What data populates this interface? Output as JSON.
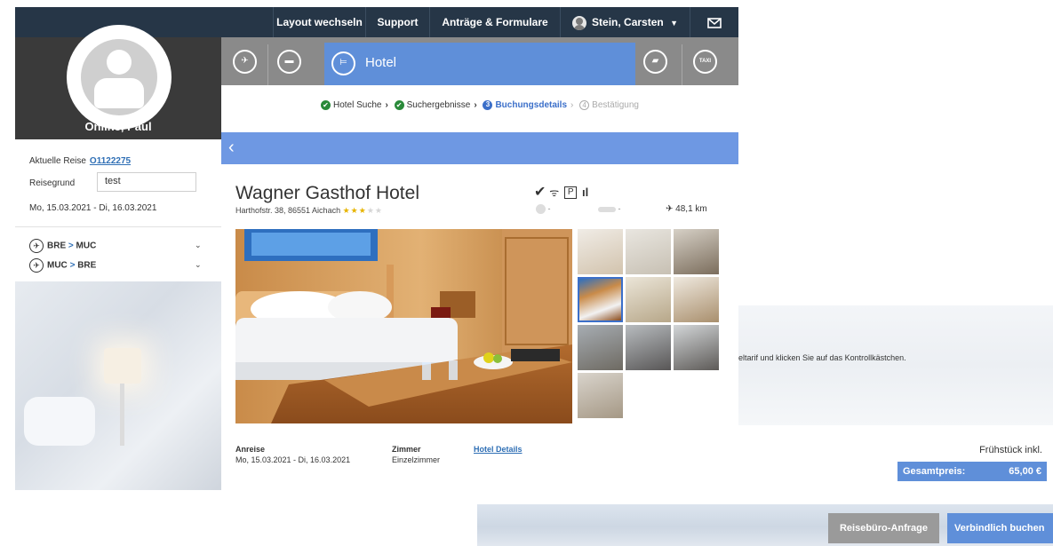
{
  "topnav": {
    "layout": "Layout wechseln",
    "support": "Support",
    "forms": "Anträge & Formulare",
    "user": "Stein, Carsten",
    "colors": {
      "bg": "#263647"
    }
  },
  "sidebar": {
    "name": "Online, Paul",
    "trip_label": "Aktuelle Reise",
    "trip_id": "O1122275",
    "reason_label": "Reisegrund",
    "reason_value": "test",
    "dates": "Mo, 15.03.2021 - Di, 16.03.2021",
    "routes": [
      {
        "from": "BRE",
        "to": "MUC"
      },
      {
        "from": "MUC",
        "to": "BRE"
      }
    ],
    "route_sep": ">"
  },
  "tabs": {
    "active_label": "Hotel",
    "taxi_label": "TAXI",
    "icons": [
      "plane-icon",
      "train-icon",
      "hotel-icon",
      "car-icon",
      "taxi-icon"
    ]
  },
  "steps": [
    {
      "label": "Hotel Suche",
      "state": "done"
    },
    {
      "label": "Suchergebnisse",
      "state": "done"
    },
    {
      "label": "Buchungsdetails",
      "state": "active",
      "num": "3"
    },
    {
      "label": "Bestätigung",
      "state": "inactive",
      "num": "4"
    }
  ],
  "hotel": {
    "name": "Wagner Gasthof Hotel",
    "address": "Harthofstr. 38, 86551 Aichach",
    "stars_filled": 3,
    "stars_total": 5,
    "meta_a": "-",
    "meta_b": "-",
    "distance": "48,1 km",
    "parking_glyph": "P"
  },
  "booking": {
    "arrival_label": "Anreise",
    "arrival_value": "Mo, 15.03.2021 - Di, 16.03.2021",
    "room_label": "Zimmer",
    "room_value": "Einzelzimmer",
    "details_link": "Hotel Details"
  },
  "right_panel": {
    "message": "eltarif und klicken Sie auf das Kontrollkästchen.",
    "breakfast": "Frühstück inkl.",
    "total_label": "Gesamtpreis:",
    "total_value": "65,00 €"
  },
  "buttons": {
    "request": "Reisebüro-Anfrage",
    "book": "Verbindlich buchen"
  },
  "colors": {
    "accent": "#5f8fd9",
    "tabbar": "#8a8a8a",
    "link": "#2f6fb5",
    "done_green": "#2a8a3a",
    "star": "#e7b400"
  }
}
